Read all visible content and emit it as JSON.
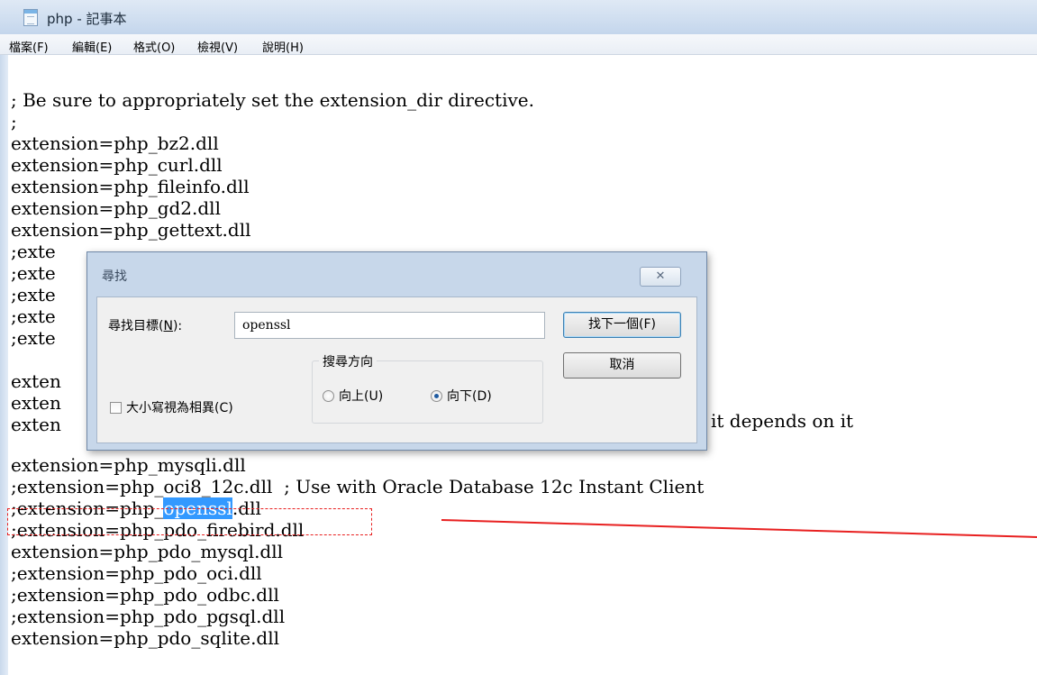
{
  "window": {
    "title": "php - 記事本"
  },
  "menu": [
    "檔案(F)",
    "編輯(E)",
    "格式(O)",
    "檢視(V)",
    "說明(H)"
  ],
  "editor_lines": [
    "; Be sure to appropriately set the extension_dir directive.",
    ";",
    "extension=php_bz2.dll",
    "extension=php_curl.dll",
    "extension=php_fileinfo.dll",
    "extension=php_gd2.dll",
    "extension=php_gettext.dll",
    ";exte",
    ";exte",
    ";exte",
    ";exte",
    ";exte",
    "exten",
    "exten",
    "exten",
    "extension=php_mysqli.dll",
    ";extension=php_oci8_12c.dll  ; Use with Oracle Database 12c Instant Client",
    ";extension=php_openssl.dll",
    ";extension=php_pdo_firebird.dll",
    "extension=php_pdo_mysql.dll",
    ";extension=php_pdo_oci.dll",
    ";extension=php_pdo_odbc.dll",
    ";extension=php_pdo_pgsql.dll",
    "extension=php_pdo_sqlite.dll"
  ],
  "visible_fragment": "it depends on it",
  "highlight": {
    "before": ";extension=php_",
    "selected": "openssl",
    "after": ".dll"
  },
  "find_dialog": {
    "title": "尋找",
    "close_glyph": "✕",
    "find_label": "尋找目標(N):",
    "find_label_prefix": "尋找目標(",
    "find_label_key": "N",
    "find_label_suffix": "):",
    "find_value": "openssl",
    "find_next_button": "找下一個(F)",
    "cancel_button": "取消",
    "direction_title": "搜尋方向",
    "direction_up": "向上(U)",
    "direction_down": "向下(D)",
    "selected_direction": "向下(D)",
    "match_case_label": "大小寫視為相異(C)",
    "match_case_checked": false
  }
}
